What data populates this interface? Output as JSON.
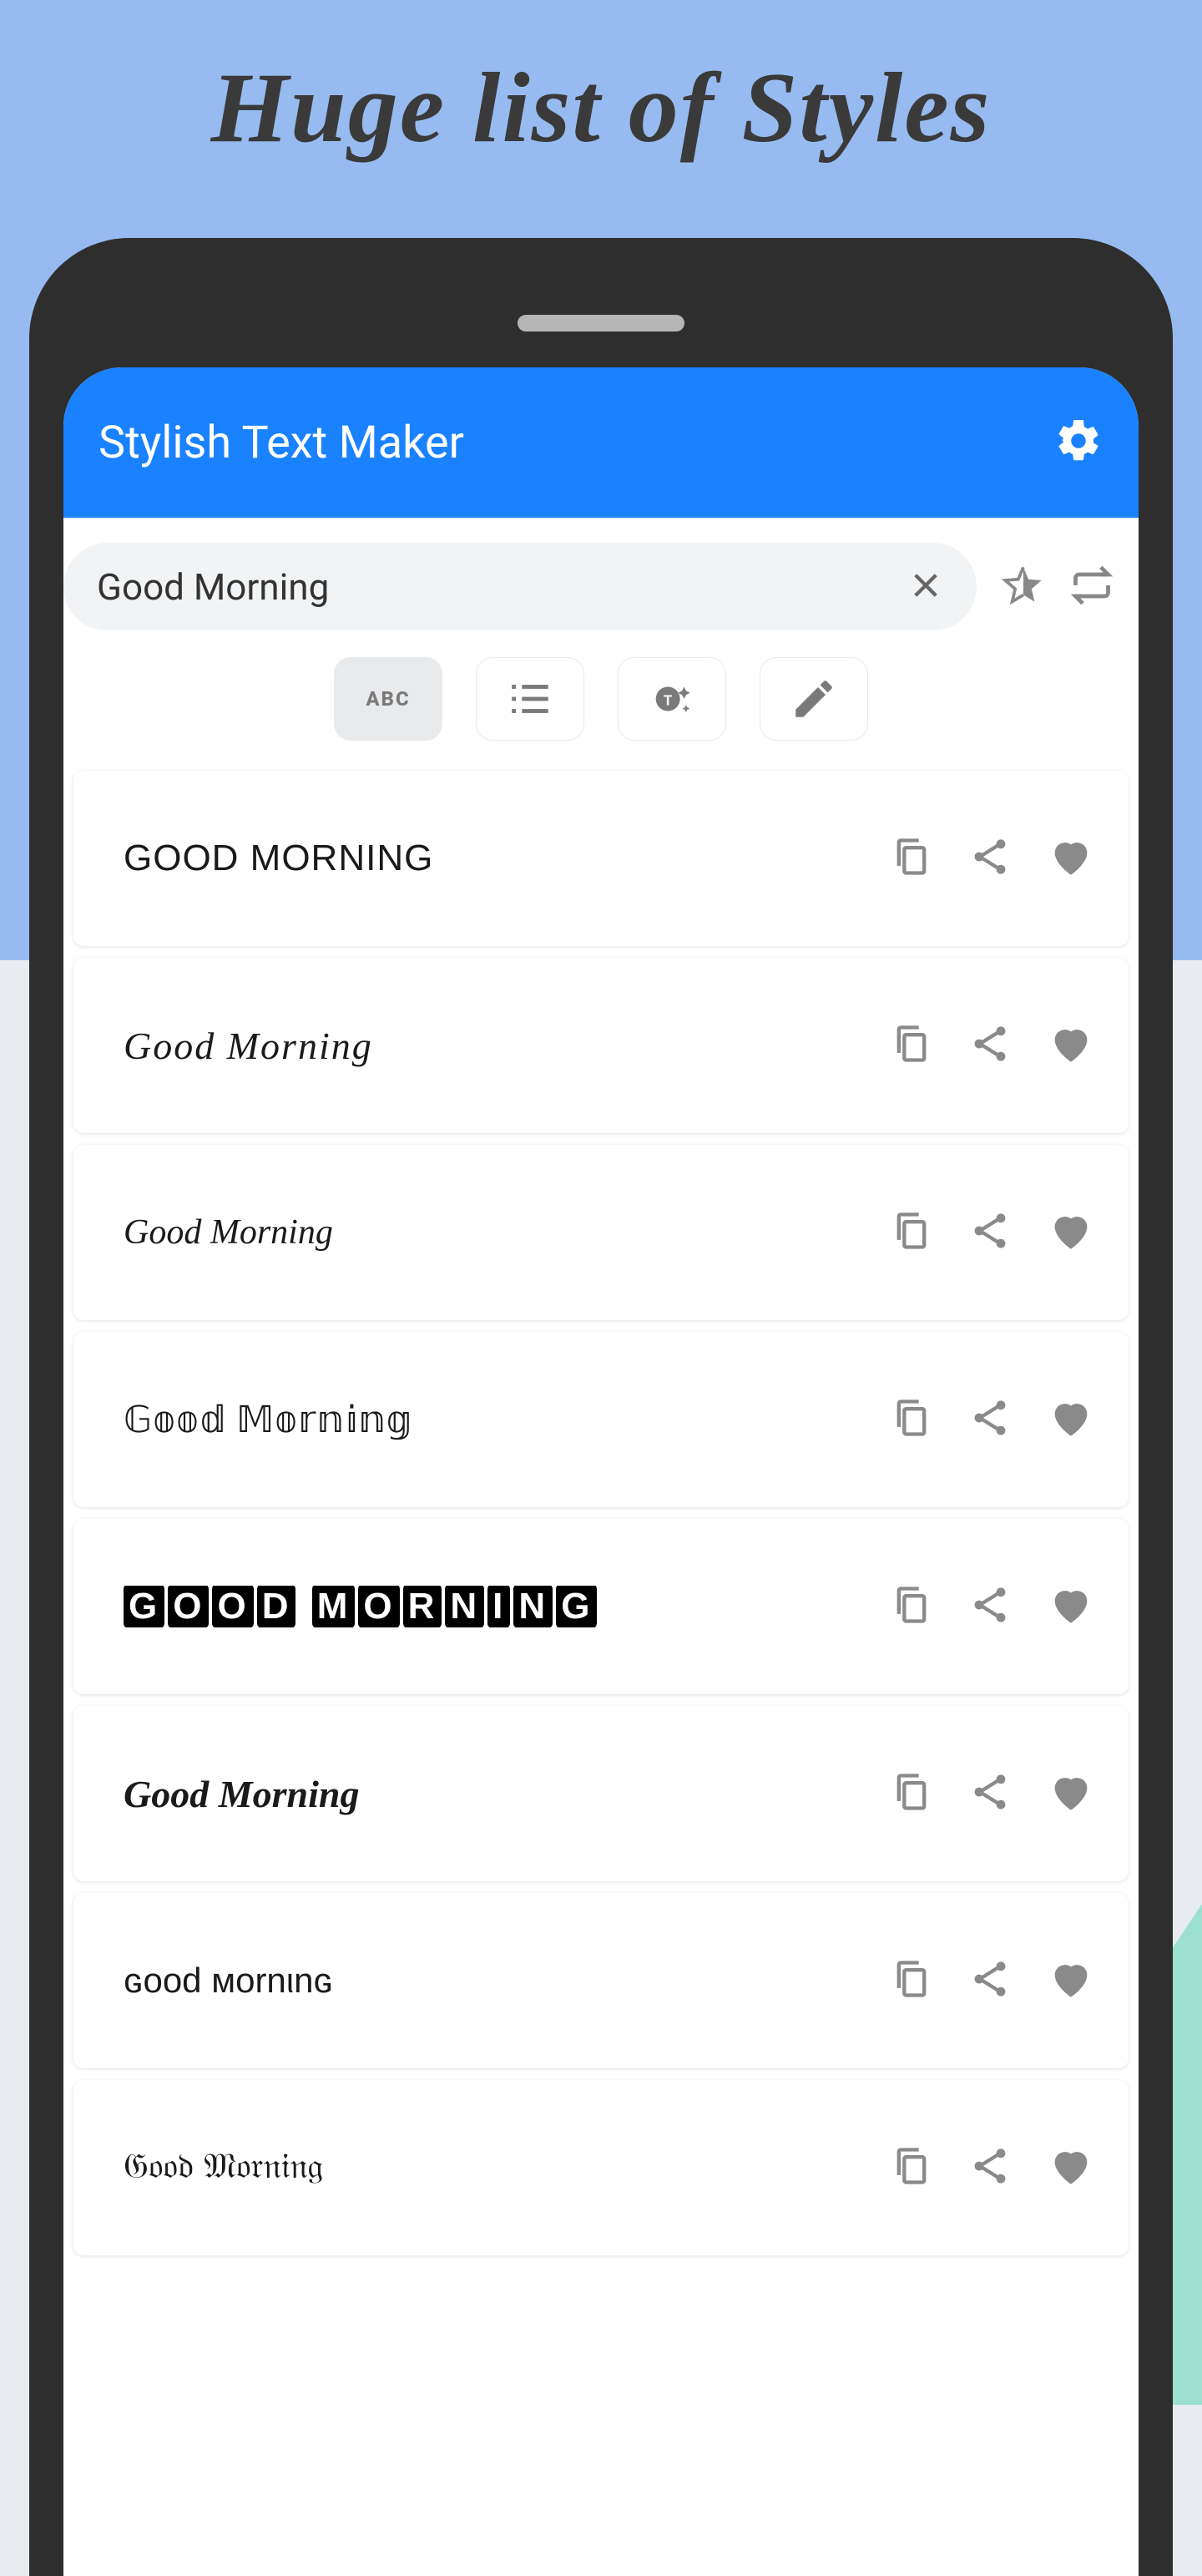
{
  "promo": {
    "title": "Huge list of Styles"
  },
  "app": {
    "title": "Stylish Text Maker"
  },
  "input": {
    "value": "Good Morning"
  },
  "tabs": {
    "abc": "ABC"
  },
  "styles": [
    {
      "text": "GOOD MORNING"
    },
    {
      "text": "Good Morning"
    },
    {
      "text": "Good Morning"
    },
    {
      "text": "𝔾𝕠𝕠𝕕 𝕄𝕠𝕣𝕟𝕚𝕟𝕘"
    },
    {
      "text": "GOOD MORNING"
    },
    {
      "text": "Good Morning"
    },
    {
      "text": "ɢood мornιnɢ"
    },
    {
      "text": "𝔊𝔬𝔬𝔡 𝔐𝔬𝔯𝔫𝔦𝔫𝔤"
    }
  ]
}
